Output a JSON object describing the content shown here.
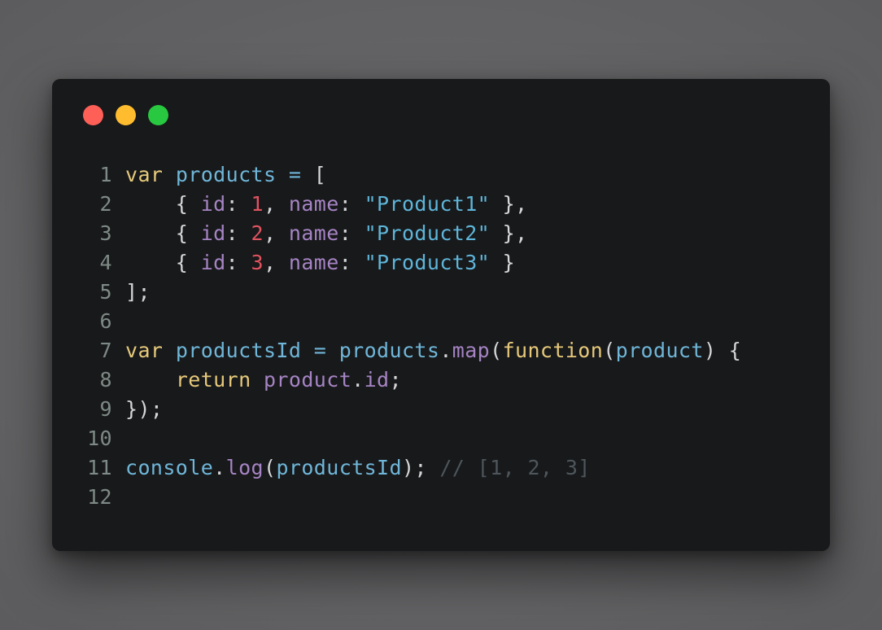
{
  "window": {
    "controls": {
      "close_color": "#fe5f57",
      "minimize_color": "#febc2e",
      "maximize_color": "#28c840"
    }
  },
  "code": {
    "language": "javascript",
    "lines": [
      {
        "number": "1",
        "tokens": [
          {
            "t": "var",
            "c": "kw"
          },
          {
            "t": " ",
            "c": "punc"
          },
          {
            "t": "products",
            "c": "var"
          },
          {
            "t": " = ",
            "c": "op"
          },
          {
            "t": "[",
            "c": "punc"
          }
        ]
      },
      {
        "number": "2",
        "tokens": [
          {
            "t": "    { ",
            "c": "punc"
          },
          {
            "t": "id",
            "c": "prop"
          },
          {
            "t": ": ",
            "c": "punc"
          },
          {
            "t": "1",
            "c": "num"
          },
          {
            "t": ", ",
            "c": "punc"
          },
          {
            "t": "name",
            "c": "prop"
          },
          {
            "t": ": ",
            "c": "punc"
          },
          {
            "t": "\"Product1\"",
            "c": "str"
          },
          {
            "t": " },",
            "c": "punc"
          }
        ]
      },
      {
        "number": "3",
        "tokens": [
          {
            "t": "    { ",
            "c": "punc"
          },
          {
            "t": "id",
            "c": "prop"
          },
          {
            "t": ": ",
            "c": "punc"
          },
          {
            "t": "2",
            "c": "num"
          },
          {
            "t": ", ",
            "c": "punc"
          },
          {
            "t": "name",
            "c": "prop"
          },
          {
            "t": ": ",
            "c": "punc"
          },
          {
            "t": "\"Product2\"",
            "c": "str"
          },
          {
            "t": " },",
            "c": "punc"
          }
        ]
      },
      {
        "number": "4",
        "tokens": [
          {
            "t": "    { ",
            "c": "punc"
          },
          {
            "t": "id",
            "c": "prop"
          },
          {
            "t": ": ",
            "c": "punc"
          },
          {
            "t": "3",
            "c": "num"
          },
          {
            "t": ", ",
            "c": "punc"
          },
          {
            "t": "name",
            "c": "prop"
          },
          {
            "t": ": ",
            "c": "punc"
          },
          {
            "t": "\"Product3\"",
            "c": "str"
          },
          {
            "t": " }",
            "c": "punc"
          }
        ]
      },
      {
        "number": "5",
        "tokens": [
          {
            "t": "];",
            "c": "punc"
          }
        ]
      },
      {
        "number": "6",
        "tokens": []
      },
      {
        "number": "7",
        "tokens": [
          {
            "t": "var",
            "c": "kw"
          },
          {
            "t": " ",
            "c": "punc"
          },
          {
            "t": "productsId",
            "c": "var"
          },
          {
            "t": " = ",
            "c": "op"
          },
          {
            "t": "products",
            "c": "var"
          },
          {
            "t": ".",
            "c": "punc"
          },
          {
            "t": "map",
            "c": "prop"
          },
          {
            "t": "(",
            "c": "punc"
          },
          {
            "t": "function",
            "c": "kw"
          },
          {
            "t": "(",
            "c": "punc"
          },
          {
            "t": "product",
            "c": "var"
          },
          {
            "t": ") {",
            "c": "punc"
          }
        ]
      },
      {
        "number": "8",
        "tokens": [
          {
            "t": "    ",
            "c": "punc"
          },
          {
            "t": "return",
            "c": "kw"
          },
          {
            "t": " ",
            "c": "punc"
          },
          {
            "t": "product",
            "c": "prop"
          },
          {
            "t": ".",
            "c": "punc"
          },
          {
            "t": "id",
            "c": "prop"
          },
          {
            "t": ";",
            "c": "punc"
          }
        ]
      },
      {
        "number": "9",
        "tokens": [
          {
            "t": "});",
            "c": "punc"
          }
        ]
      },
      {
        "number": "10",
        "tokens": []
      },
      {
        "number": "11",
        "tokens": [
          {
            "t": "console",
            "c": "var"
          },
          {
            "t": ".",
            "c": "punc"
          },
          {
            "t": "log",
            "c": "prop"
          },
          {
            "t": "(",
            "c": "punc"
          },
          {
            "t": "productsId",
            "c": "var"
          },
          {
            "t": "); ",
            "c": "punc"
          },
          {
            "t": "// [1, 2, 3]",
            "c": "cmt"
          }
        ]
      },
      {
        "number": "12",
        "tokens": []
      }
    ]
  },
  "colors": {
    "background": "#18191b",
    "keyword": "#e6c97a",
    "variable": "#6fb6d8",
    "property": "#a684c4",
    "number": "#e0535f",
    "string": "#5eb5d9",
    "comment": "#4d565b",
    "line_number": "#7e8a86"
  }
}
